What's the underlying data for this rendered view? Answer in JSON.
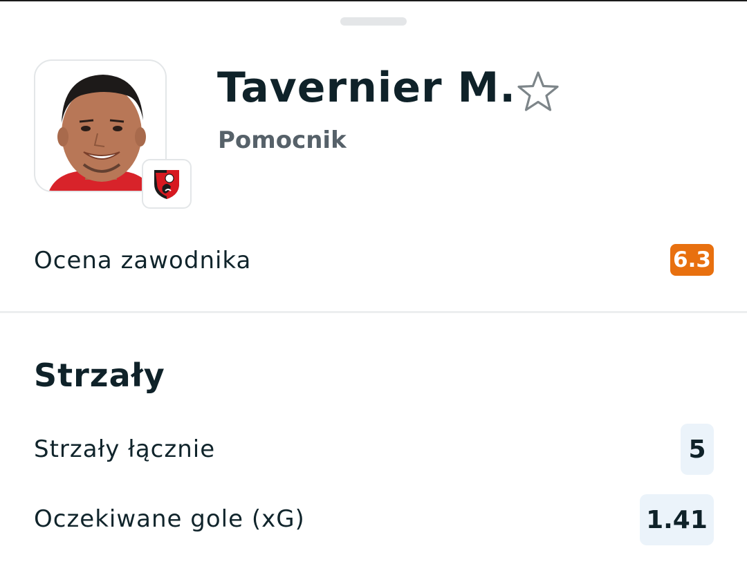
{
  "player": {
    "name": "Tavernier M.",
    "position": "Pomocnik",
    "photo_icon": "player-photo",
    "club_icon": "afc-bournemouth-crest"
  },
  "rating": {
    "label": "Ocena zawodnika",
    "value": "6.3",
    "color": "#e8700f"
  },
  "shots_section": {
    "title": "Strzały",
    "rows": [
      {
        "label": "Strzały łącznie",
        "value": "5"
      },
      {
        "label": "Oczekiwane gole (xG)",
        "value": "1.41"
      }
    ]
  },
  "colors": {
    "value_bg": "#ebf3fa",
    "text_dark": "#0f2229",
    "text_muted": "#566169"
  }
}
